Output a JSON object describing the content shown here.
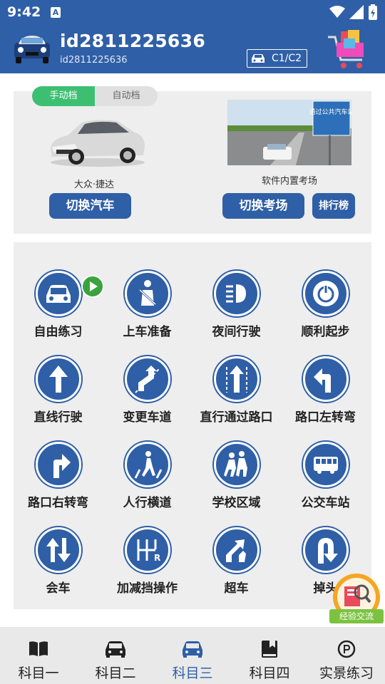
{
  "status": {
    "time": "9:42",
    "notif_icon": "A"
  },
  "header": {
    "username": "id2811225636",
    "userid": "id2811225636",
    "license": "C1/C2",
    "avatar_icon": "car-avatar-icon",
    "cart_icon": "shopping-cart-icon"
  },
  "card": {
    "gear_options": [
      "手动档",
      "自动档"
    ],
    "selected_gear": "手动档",
    "car_name": "大众·捷达",
    "switch_car": "切换汽车",
    "exam_label": "软件内置考场",
    "switch_exam": "切换考场",
    "rank": "排行榜",
    "sign_text": "通过公共汽车站"
  },
  "grid": [
    {
      "label": "自由练习",
      "icon": "car-front-icon"
    },
    {
      "label": "上车准备",
      "icon": "seatbelt-icon"
    },
    {
      "label": "夜间行驶",
      "icon": "headlight-icon"
    },
    {
      "label": "顺利起步",
      "icon": "power-icon"
    },
    {
      "label": "直线行驶",
      "icon": "arrow-up-icon"
    },
    {
      "label": "变更车道",
      "icon": "lane-change-icon"
    },
    {
      "label": "直行通过路口",
      "icon": "straight-through-icon"
    },
    {
      "label": "路口左转弯",
      "icon": "turn-left-icon"
    },
    {
      "label": "路口右转弯",
      "icon": "turn-right-icon"
    },
    {
      "label": "人行横道",
      "icon": "crosswalk-icon"
    },
    {
      "label": "学校区域",
      "icon": "school-zone-icon"
    },
    {
      "label": "公交车站",
      "icon": "bus-icon"
    },
    {
      "label": "会车",
      "icon": "two-way-icon"
    },
    {
      "label": "加减挡操作",
      "icon": "gear-shift-icon"
    },
    {
      "label": "超车",
      "icon": "overtake-icon"
    },
    {
      "label": "掉头",
      "icon": "u-turn-icon"
    }
  ],
  "exchange": {
    "label": "经验交流"
  },
  "nav": [
    {
      "label": "科目一",
      "icon": "book-icon"
    },
    {
      "label": "科目二",
      "icon": "car-icon"
    },
    {
      "label": "科目三",
      "icon": "car-icon"
    },
    {
      "label": "科目四",
      "icon": "bookmark-book-icon"
    },
    {
      "label": "实景练习",
      "icon": "parking-icon"
    }
  ],
  "nav_active": "科目三",
  "colors": {
    "primary": "#2f5fa6",
    "accent_green": "#3dbf72",
    "badge_green": "#3aa33d",
    "orange": "#f5a623"
  }
}
